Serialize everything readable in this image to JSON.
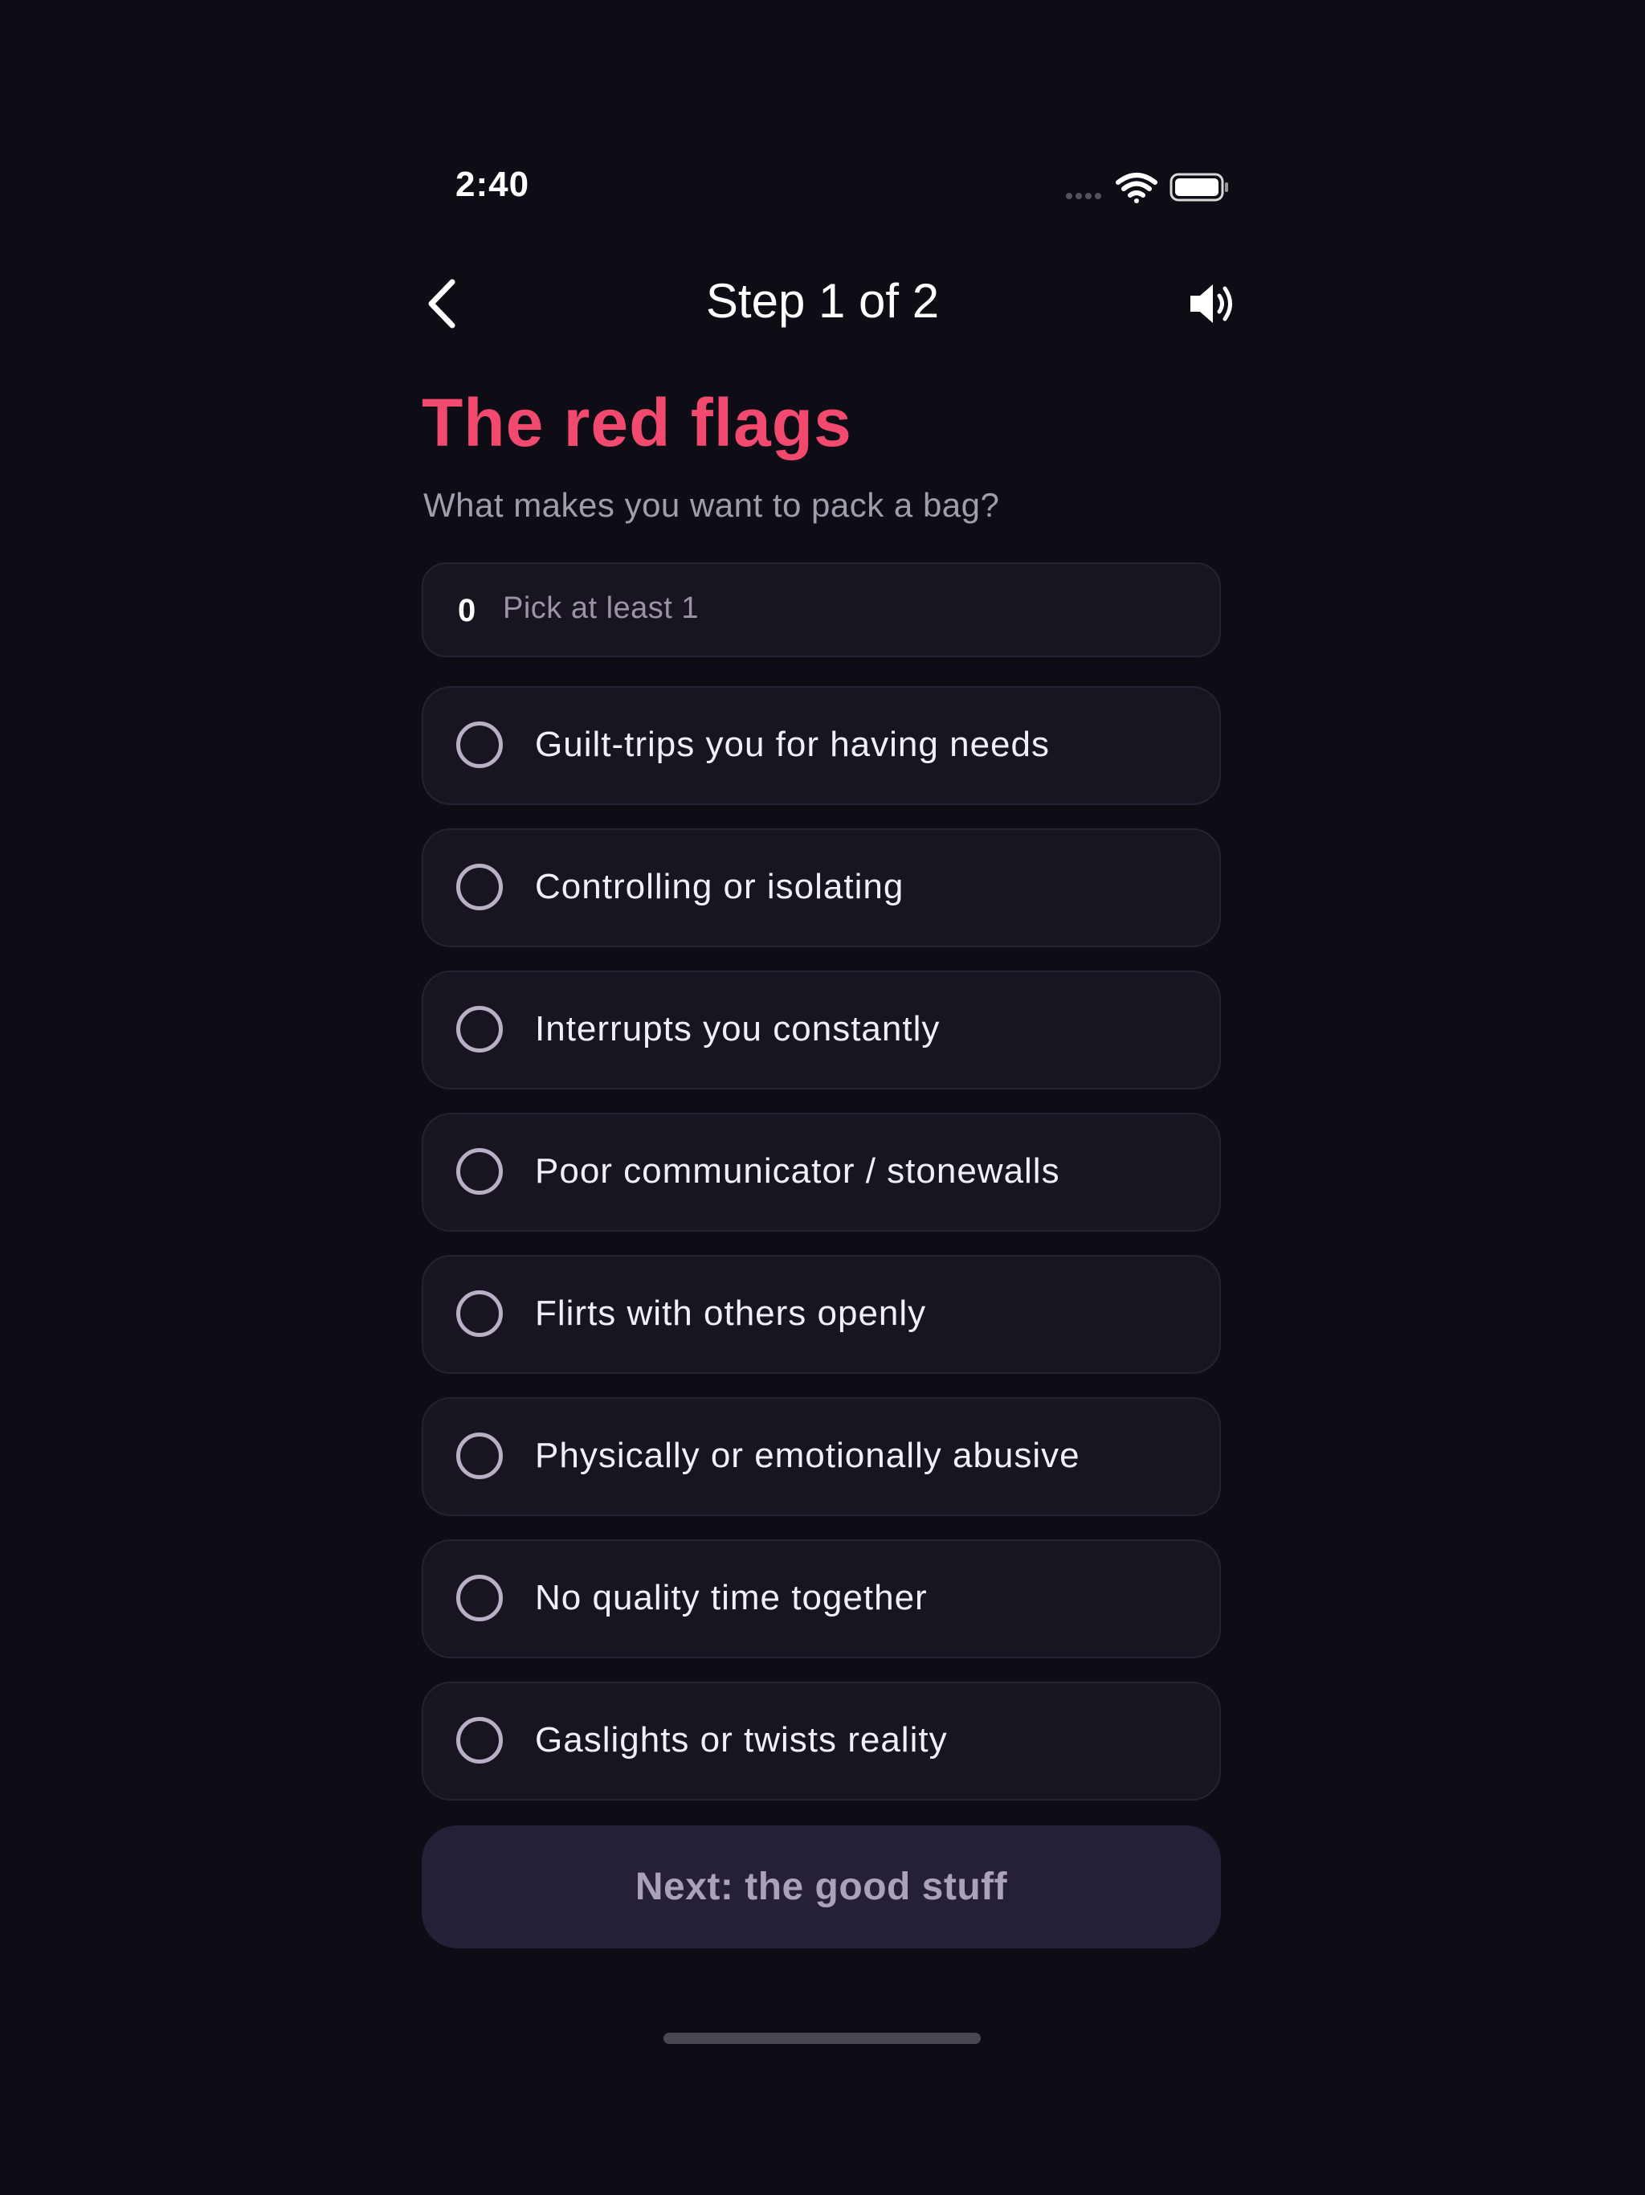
{
  "status_bar": {
    "time": "2:40",
    "icons": [
      "cellular-signal-icon",
      "wifi-icon",
      "battery-icon"
    ]
  },
  "nav": {
    "back_icon": "chevron-left-icon",
    "title": "Step 1 of 2",
    "sound_icon": "speaker-icon"
  },
  "header": {
    "title": "The red flags",
    "subtitle": "What makes you want to pack a bag?"
  },
  "counter": {
    "count": "0",
    "label": "Pick at least 1"
  },
  "options": [
    {
      "label": "Guilt-trips you for having needs",
      "selected": false
    },
    {
      "label": "Controlling or isolating",
      "selected": false
    },
    {
      "label": "Interrupts you constantly",
      "selected": false
    },
    {
      "label": "Poor communicator / stonewalls",
      "selected": false
    },
    {
      "label": "Flirts with others openly",
      "selected": false
    },
    {
      "label": "Physically or emotionally abusive",
      "selected": false
    },
    {
      "label": "No quality time together",
      "selected": false
    },
    {
      "label": "Gaslights or twists reality",
      "selected": false
    }
  ],
  "next_button": {
    "label": "Next: the good stuff",
    "enabled": false
  },
  "colors": {
    "background": "#0e0c15",
    "accent": "#f24a6e",
    "card": "#181521",
    "button": "#261f38"
  }
}
